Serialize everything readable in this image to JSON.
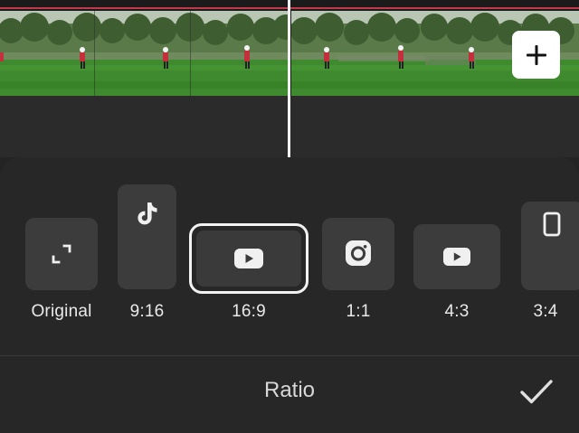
{
  "timeline": {
    "add_button_icon": "plus-icon"
  },
  "ratio_options": [
    {
      "label": "Original",
      "icon": "crop-corners-icon",
      "selected": false
    },
    {
      "label": "9:16",
      "icon": "tiktok-icon",
      "selected": false
    },
    {
      "label": "16:9",
      "icon": "youtube-icon",
      "selected": true
    },
    {
      "label": "1:1",
      "icon": "instagram-icon",
      "selected": false
    },
    {
      "label": "4:3",
      "icon": "youtube-icon",
      "selected": false
    },
    {
      "label": "3:4",
      "icon": "portrait-frame-icon",
      "selected": false
    }
  ],
  "panel": {
    "title": "Ratio",
    "confirm_icon": "checkmark-icon"
  },
  "colors": {
    "background": "#232323",
    "tile": "#3c3c3c",
    "selection_border": "#f2f2f2",
    "timeline_marker": "#c23a4a"
  }
}
